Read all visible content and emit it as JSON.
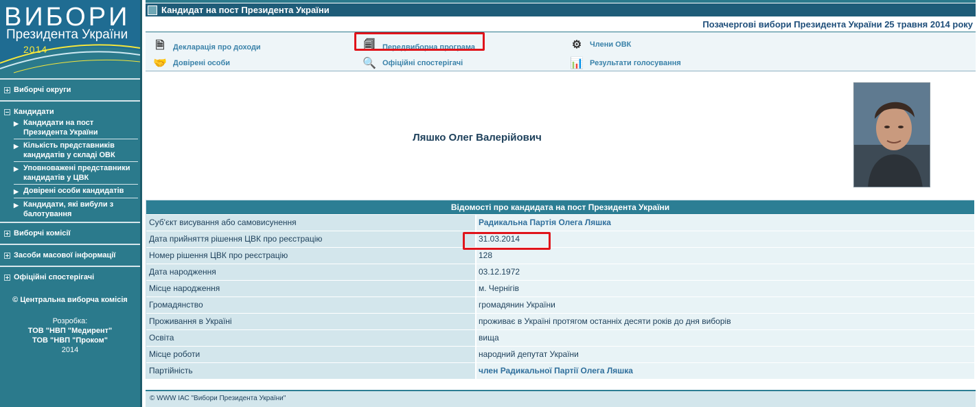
{
  "logo": {
    "title": "ВИБОРИ",
    "subtitle": "Президента України",
    "year": "2014"
  },
  "sidebar": {
    "sections": [
      {
        "label": "Виборчі округи"
      },
      {
        "label": "Кандидати"
      },
      {
        "label": "Виборчі комісії"
      },
      {
        "label": "Засоби масової інформації"
      },
      {
        "label": "Офіційні спостерігачі"
      }
    ],
    "candidates_items": [
      {
        "label": "Кандидати на пост Президента України"
      },
      {
        "label": "Кількість представників кандидатів у складі ОВК"
      },
      {
        "label": "Уповноважені представники кандидатів у ЦВК"
      },
      {
        "label": "Довірені особи кандидатів"
      },
      {
        "label": "Кандидати, які вибули з балотування"
      }
    ],
    "copyright": "© Центральна виборча комісія",
    "dev_label": "Розробка:",
    "dev_org1": "ТОВ \"НВП \"Медирент\"",
    "dev_org2": "ТОВ \"НВП \"Проком\"",
    "dev_year": "2014"
  },
  "header": {
    "title": "Кандидат на пост Президента України"
  },
  "election": "Позачергові вибори Президента України 25 травня 2014 року",
  "nav": {
    "declaration": "Декларація про доходи",
    "program": "Передвиборна програма",
    "members": "Члени ОВК",
    "trusted": "Довірені особи",
    "observers": "Офіційні спостерігачі",
    "results": "Результати голосування"
  },
  "candidate": {
    "name": "Ляшко Олег Валерійович"
  },
  "info": {
    "heading": "Відомості про кандидата на пост Президента України",
    "rows": [
      {
        "key": "Суб'єкт висування або самовисунення",
        "value": "Радикальна Партія Олега Ляшка"
      },
      {
        "key": "Дата прийняття рішення ЦВК про реєстрацію",
        "value": "31.03.2014"
      },
      {
        "key": "Номер рішення ЦВК про реєстрацію",
        "value": "128"
      },
      {
        "key": "Дата народження",
        "value": "03.12.1972"
      },
      {
        "key": "Місце народження",
        "value": "м. Чернігів"
      },
      {
        "key": "Громадянство",
        "value": "громадянин України"
      },
      {
        "key": "Проживання в Україні",
        "value": "проживає в Україні протягом останніх десяти років до дня виборів"
      },
      {
        "key": "Освіта",
        "value": "вища"
      },
      {
        "key": "Місце роботи",
        "value": "народний депутат України"
      },
      {
        "key": "Партійність",
        "value": "член Радикальної Партії Олега Ляшка"
      }
    ]
  },
  "footer": "© WWW ІАС \"Вибори Президента України\"",
  "colors": {
    "sidebar": "#2b7a8c",
    "header": "#1e5c78",
    "highlight": "#e0141b",
    "link": "#3a82a9"
  }
}
